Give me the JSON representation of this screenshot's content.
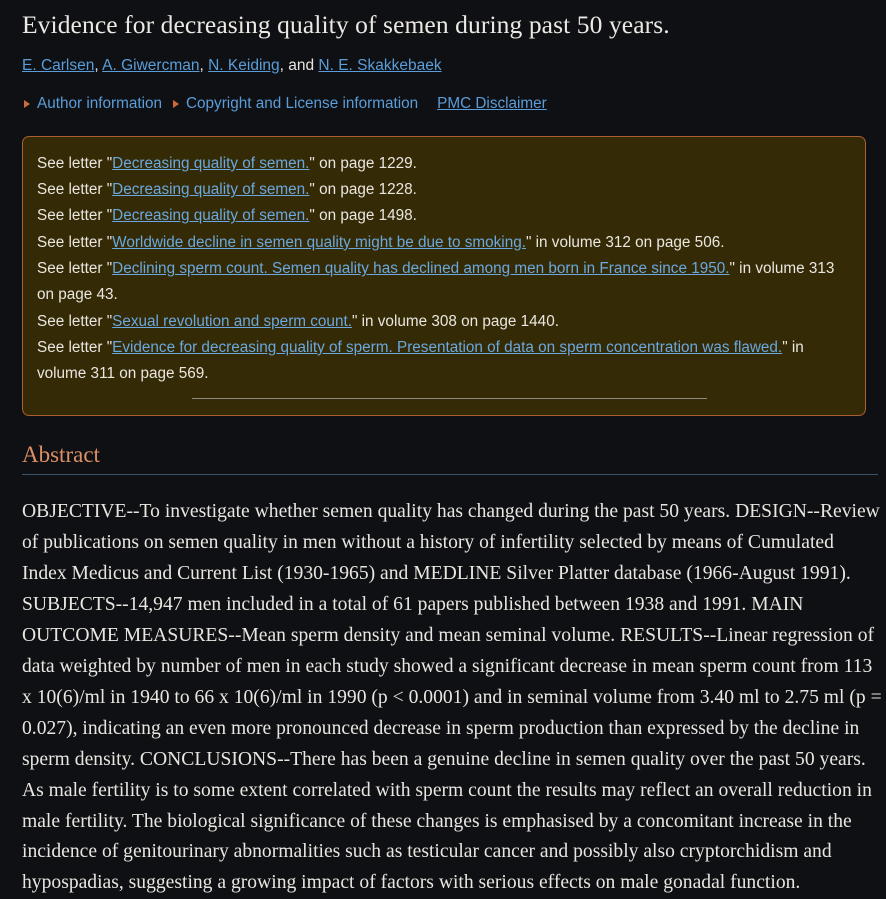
{
  "theme": {
    "page_bg": "#0e1013",
    "text": "#e8e6e3",
    "link": "#5b9dd9",
    "box_bg": "#342a06",
    "box_border": "#a9602c",
    "accent_heading": "#dd8f65",
    "bullet": "#cf6a3b",
    "rule": "#3c5366"
  },
  "article": {
    "title": "Evidence for decreasing quality of semen during past 50 years."
  },
  "authors": {
    "list": [
      {
        "name": "E. Carlsen"
      },
      {
        "name": "A. Giwercman"
      },
      {
        "name": "N. Keiding"
      },
      {
        "name": "N. E. Skakkebaek"
      }
    ],
    "conjunction": "and",
    "separator": ", "
  },
  "meta_links": {
    "bullet_icon": "triangle-right-icon",
    "items": [
      {
        "label": "Author information",
        "has_bullet": true,
        "underlined": false
      },
      {
        "label": "Copyright and License information",
        "has_bullet": true,
        "underlined": false
      },
      {
        "label": "PMC Disclaimer",
        "has_bullet": false,
        "underlined": true
      }
    ]
  },
  "letters_box": {
    "entries": [
      {
        "prefix": "See letter \"",
        "link": "Decreasing quality of semen.",
        "suffix": "\" on page 1229."
      },
      {
        "prefix": "See letter \"",
        "link": "Decreasing quality of semen.",
        "suffix": "\" on page 1228."
      },
      {
        "prefix": "See letter \"",
        "link": "Decreasing quality of semen.",
        "suffix": "\" on page 1498."
      },
      {
        "prefix": "See letter \"",
        "link": "Worldwide decline in semen quality might be due to smoking.",
        "suffix": "\" in volume 312 on page 506."
      },
      {
        "prefix": "See letter \"",
        "link": "Declining sperm count. Semen quality has declined among men born in France since 1950.",
        "suffix": "\" in volume 313 on page 43."
      },
      {
        "prefix": "See letter \"",
        "link": "Sexual revolution and sperm count.",
        "suffix": "\" in volume 308 on page 1440."
      },
      {
        "prefix": "See letter \"",
        "link": "Evidence for decreasing quality of sperm. Presentation of data on sperm concentration was flawed.",
        "suffix": "\" in volume 311 on page 569."
      }
    ]
  },
  "abstract": {
    "heading": "Abstract",
    "body": "OBJECTIVE--To investigate whether semen quality has changed during the past 50 years. DESIGN--Review of publications on semen quality in men without a history of infertility selected by means of Cumulated Index Medicus and Current List (1930-1965) and MEDLINE Silver Platter database (1966-August 1991). SUBJECTS--14,947 men included in a total of 61 papers published between 1938 and 1991. MAIN OUTCOME MEASURES--Mean sperm density and mean seminal volume. RESULTS--Linear regression of data weighted by number of men in each study showed a significant decrease in mean sperm count from 113 x 10(6)/ml in 1940 to 66 x 10(6)/ml in 1990 (p < 0.0001) and in seminal volume from 3.40 ml to 2.75 ml (p = 0.027), indicating an even more pronounced decrease in sperm production than expressed by the decline in sperm density. CONCLUSIONS--There has been a genuine decline in semen quality over the past 50 years. As male fertility is to some extent correlated with sperm count the results may reflect an overall reduction in male fertility. The biological significance of these changes is emphasised by a concomitant increase in the incidence of genitourinary abnormalities such as testicular cancer and possibly also cryptorchidism and hypospadias, suggesting a growing impact of factors with serious effects on male gonadal function."
  }
}
